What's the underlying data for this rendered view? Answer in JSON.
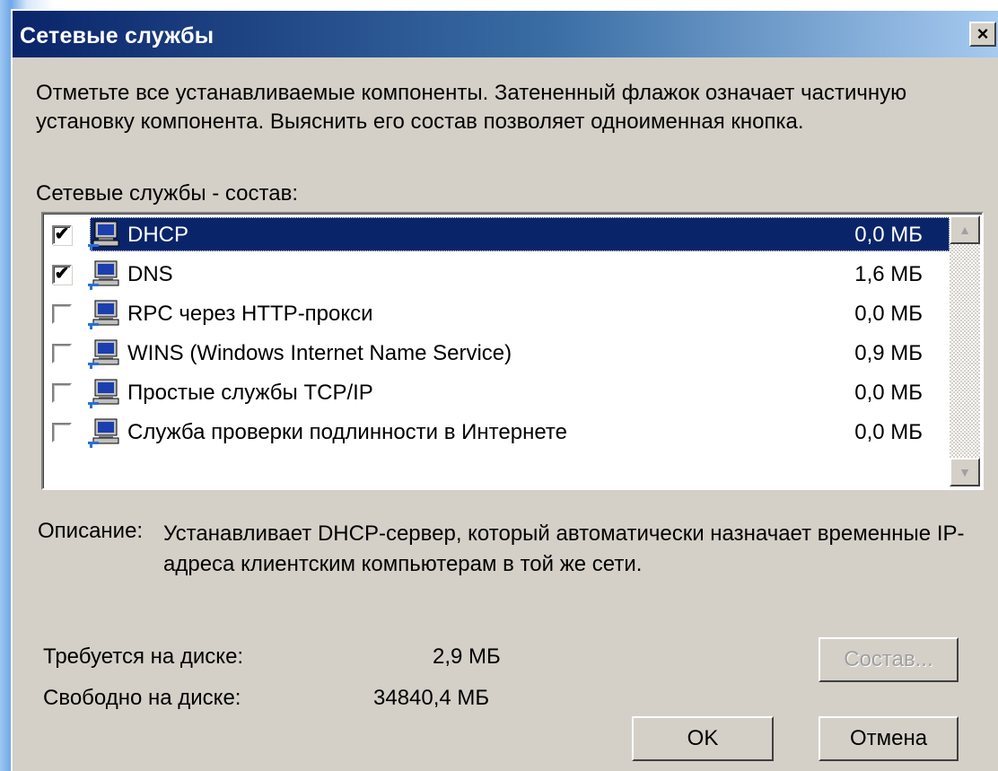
{
  "window": {
    "title": "Сетевые службы",
    "close_glyph": "×"
  },
  "intro_text": "Отметьте все устанавливаемые компоненты. Затененный флажок означает частичную установку компонента. Выяснить его состав позволяет одноименная кнопка.",
  "list_label": "Сетевые службы - состав:",
  "components": [
    {
      "label": "DHCP",
      "size": "0,0 МБ",
      "checked": true,
      "check_glyph": "✔",
      "icon": "network-computer-icon",
      "selected": true
    },
    {
      "label": "DNS",
      "size": "1,6 МБ",
      "checked": true,
      "check_glyph": "✔",
      "icon": "network-computer-icon",
      "selected": false
    },
    {
      "label": "RPC через HTTP-прокси",
      "size": "0,0 МБ",
      "checked": false,
      "check_glyph": "",
      "icon": "network-computer-icon",
      "selected": false
    },
    {
      "label": "WINS (Windows Internet Name Service)",
      "size": "0,9 МБ",
      "checked": false,
      "check_glyph": "",
      "icon": "network-computer-icon",
      "selected": false
    },
    {
      "label": "Простые службы TCP/IP",
      "size": "0,0 МБ",
      "checked": false,
      "check_glyph": "",
      "icon": "network-computer-icon",
      "selected": false
    },
    {
      "label": "Служба проверки подлинности в Интернете",
      "size": "0,0 МБ",
      "checked": false,
      "check_glyph": "",
      "icon": "network-computer-icon",
      "selected": false
    }
  ],
  "scrollbar": {
    "up_glyph": "▲",
    "down_glyph": "▼"
  },
  "description": {
    "label": "Описание:",
    "text": "Устанавливает DHCP-сервер, который автоматически назначает временные IP-адреса клиентским компьютерам в той же сети."
  },
  "disk": {
    "required_label": "Требуется на диске:",
    "required_value": "2,9 МБ",
    "free_label": "Свободно на диске:",
    "free_value": "34840,4 МБ"
  },
  "buttons": {
    "components": "Состав...",
    "ok": "OK",
    "cancel": "Отмена"
  },
  "colors": {
    "titlebar_start": "#0a246a",
    "titlebar_end": "#a6caf0",
    "dialog_face": "#d4d0c8",
    "selection": "#0a246a"
  }
}
